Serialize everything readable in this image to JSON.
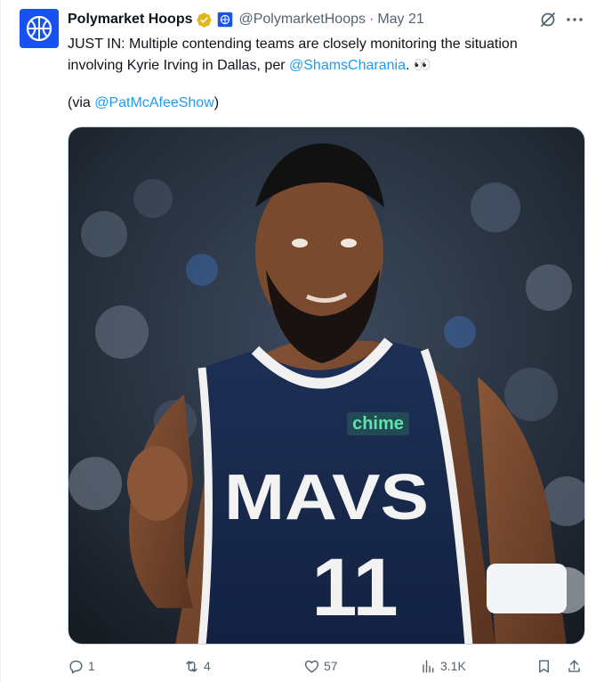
{
  "account": {
    "name": "Polymarket Hoops",
    "handle": "@PolymarketHoops",
    "separator": "·",
    "date": "May 21",
    "avatar_icon": "basketball-logo-icon",
    "brand_color": "#1652f0"
  },
  "tweet": {
    "text_before_mention": "JUST IN: Multiple contending teams are closely monitoring the situation involving Kyrie Irving in Dallas, per ",
    "mention": "@ShamsCharania",
    "text_after_mention": ". 👀",
    "via_prefix": "(via ",
    "via_mention": "@PatMcAfeeShow",
    "via_suffix": ")"
  },
  "media": {
    "jersey_brand": "chime",
    "jersey_team": "MAVS",
    "jersey_number": "11"
  },
  "actions": {
    "replies": "1",
    "reposts": "4",
    "likes": "57",
    "views": "3.1K"
  },
  "colors": {
    "text": "#0f1419",
    "secondary": "#536471",
    "link": "#1d9bf0",
    "verified_gold": "#e2b719"
  }
}
